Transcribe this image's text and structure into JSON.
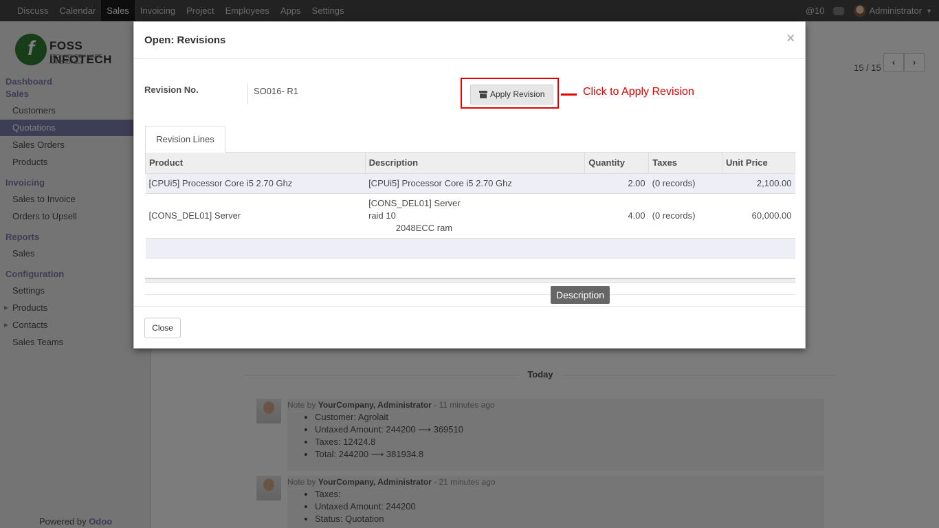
{
  "topbar": {
    "menu": [
      "Discuss",
      "Calendar",
      "Sales",
      "Invoicing",
      "Project",
      "Employees",
      "Apps",
      "Settings"
    ],
    "active": "Sales",
    "mentions": "@10",
    "user": "Administrator"
  },
  "logo": {
    "name": "FOSS INFOTECH",
    "tagline": "TECHNOLOGY MADE AFFORDABLE"
  },
  "sidebar": {
    "dashboard": "Dashboard",
    "sales_section": "Sales",
    "sales_items": [
      "Customers",
      "Quotations",
      "Sales Orders",
      "Products"
    ],
    "invoicing_section": "Invoicing",
    "invoicing_items": [
      "Sales to Invoice",
      "Orders to Upsell"
    ],
    "reports_section": "Reports",
    "reports_items": [
      "Sales"
    ],
    "config_section": "Configuration",
    "config_items": [
      "Settings",
      "Products",
      "Contacts",
      "Sales Teams"
    ],
    "powered_prefix": "Powered by",
    "powered_brand": "Odoo"
  },
  "pager": {
    "text": "15 / 15",
    "prev": "‹",
    "next": "›"
  },
  "chatter": {
    "today": "Today",
    "messages": [
      {
        "prefix": "Note by",
        "author": "YourCompany, Administrator",
        "time": "- 11 minutes ago",
        "lines": [
          "Customer: Agrolait",
          "Untaxed Amount: 244200 ⟶ 369510",
          "Taxes: 12424.8",
          "Total: 244200 ⟶ 381934.8"
        ]
      },
      {
        "prefix": "Note by",
        "author": "YourCompany, Administrator",
        "time": "- 21 minutes ago",
        "lines": [
          "Taxes:",
          "Untaxed Amount: 244200",
          "Status: Quotation"
        ]
      }
    ]
  },
  "modal": {
    "title": "Open: Revisions",
    "close_x": "×",
    "revision_label": "Revision No.",
    "revision_value": "SO016- R1",
    "apply_label": "Apply Revision",
    "callout": "Click to Apply Revision",
    "tab": "Revision Lines",
    "columns": [
      "Product",
      "Description",
      "Quantity",
      "Taxes",
      "Unit Price"
    ],
    "rows": [
      {
        "product": "[CPUi5] Processor Core i5 2.70 Ghz",
        "description": "[CPUi5] Processor Core i5 2.70 Ghz",
        "quantity": "2.00",
        "taxes": "(0 records)",
        "unit_price": "2,100.00"
      },
      {
        "product": "[CONS_DEL01] Server",
        "description": "[CONS_DEL01] Server\nraid 10\n           2048ECC ram",
        "quantity": "4.00",
        "taxes": "(0 records)",
        "unit_price": "60,000.00"
      }
    ],
    "tooltip": "Description",
    "close_button": "Close"
  }
}
